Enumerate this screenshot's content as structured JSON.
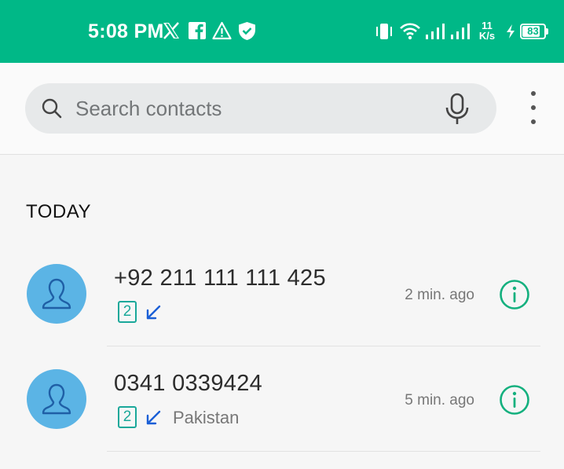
{
  "status_bar": {
    "time": "5:08 PM",
    "net_speed_value": "11",
    "net_speed_unit": "K/s",
    "battery": "83",
    "battery_level": 0.83,
    "icons": [
      "x-icon",
      "facebook-icon",
      "warning-icon",
      "shield-icon",
      "vibrate-icon",
      "wifi-icon",
      "signal-icon",
      "signal-icon",
      "charging-icon",
      "battery-icon"
    ]
  },
  "search": {
    "placeholder": "Search contacts"
  },
  "section": {
    "title": "TODAY"
  },
  "calls": [
    {
      "number": "+92 211 111 111 425",
      "sim": "2",
      "direction": "incoming",
      "location": "",
      "time_ago": "2 min. ago"
    },
    {
      "number": "0341 0339424",
      "sim": "2",
      "direction": "incoming",
      "location": "Pakistan",
      "time_ago": "5 min. ago"
    }
  ],
  "colors": {
    "status_bar": "#00b887",
    "avatar": "#5bb4e5",
    "accent": "#1aa89a",
    "incoming_arrow": "#1a5fd6"
  }
}
